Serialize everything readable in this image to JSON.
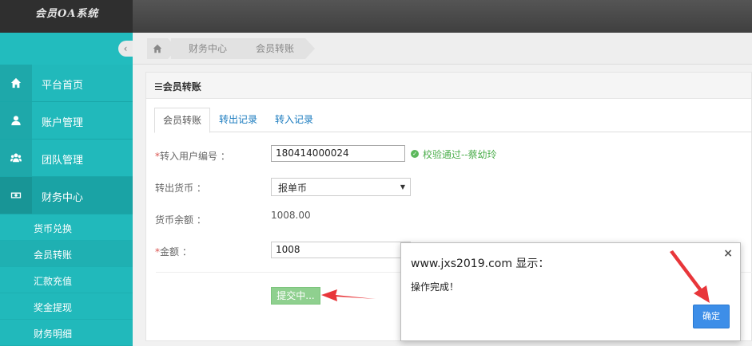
{
  "app": {
    "title": "会员OA系统"
  },
  "sidebar": {
    "toggle": "‹",
    "items": [
      {
        "label": "平台首页",
        "icon": "home-icon"
      },
      {
        "label": "账户管理",
        "icon": "user-icon"
      },
      {
        "label": "团队管理",
        "icon": "team-icon"
      },
      {
        "label": "财务中心",
        "icon": "money-icon"
      }
    ],
    "sub_items": [
      {
        "label": "货币兑换"
      },
      {
        "label": "会员转账"
      },
      {
        "label": "汇款充值"
      },
      {
        "label": "奖金提现"
      },
      {
        "label": "财务明细"
      }
    ]
  },
  "breadcrumb": {
    "items": [
      "财务中心",
      "会员转账"
    ]
  },
  "panel": {
    "title": "☰会员转账",
    "tabs": [
      "会员转账",
      "转出记录",
      "转入记录"
    ]
  },
  "form": {
    "user_id_label": "转入用户编号 ：",
    "user_id_value": "180414000024",
    "verify_text": "校验通过--蔡幼玲",
    "currency_label": "转出货币 ：",
    "currency_value": "报单币",
    "balance_label": "货币余额 ：",
    "balance_value": "1008.00",
    "amount_label": "金额 ：",
    "amount_value": "1008",
    "required_mark": "*",
    "submit_label": "提交中..."
  },
  "dialog": {
    "title": "www.jxs2019.com 显示：",
    "message": "操作完成！",
    "close": "×",
    "ok_label": "确定"
  },
  "colors": {
    "sidebar": "#21b9bb",
    "success": "#4cae4c",
    "primary": "#3d8ee8",
    "arrow": "#e8363a"
  }
}
